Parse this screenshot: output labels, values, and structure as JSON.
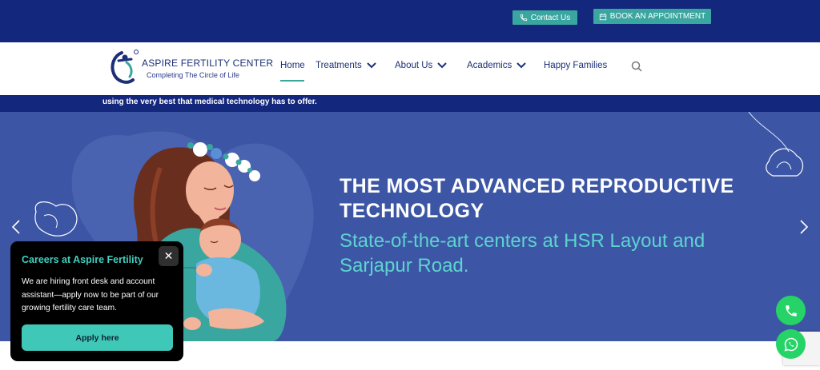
{
  "topbar": {
    "contact_label": "Contact Us",
    "book_label": "BOOK AN APPOINTMENT"
  },
  "brand": {
    "name": "ASPIRE FERTILITY CENTER",
    "tagline": "Completing The Circle of Life"
  },
  "nav": {
    "items": [
      {
        "label": "Home"
      },
      {
        "label": "Treatments"
      },
      {
        "label": "About Us"
      },
      {
        "label": "Academics"
      },
      {
        "label": "Happy Families"
      }
    ]
  },
  "ticker": {
    "text": "using the very best that medical technology has to offer."
  },
  "hero": {
    "title": "THE MOST ADVANCED REPRODUCTIVE TECHNOLOGY",
    "subtitle": "State-of-the-art centers at HSR Layout and Sarjapur Road."
  },
  "popup": {
    "title": "Careers at Aspire Fertility",
    "body": "We are hiring front desk and account assistant—apply now to be part of our growing fertility care team.",
    "button_label": "Apply here",
    "close_label": "✕"
  },
  "colors": {
    "navy": "#13277d",
    "teal": "#3aa6a0",
    "hero_bg": "#3c56a5",
    "whatsapp_green": "#25d366"
  }
}
